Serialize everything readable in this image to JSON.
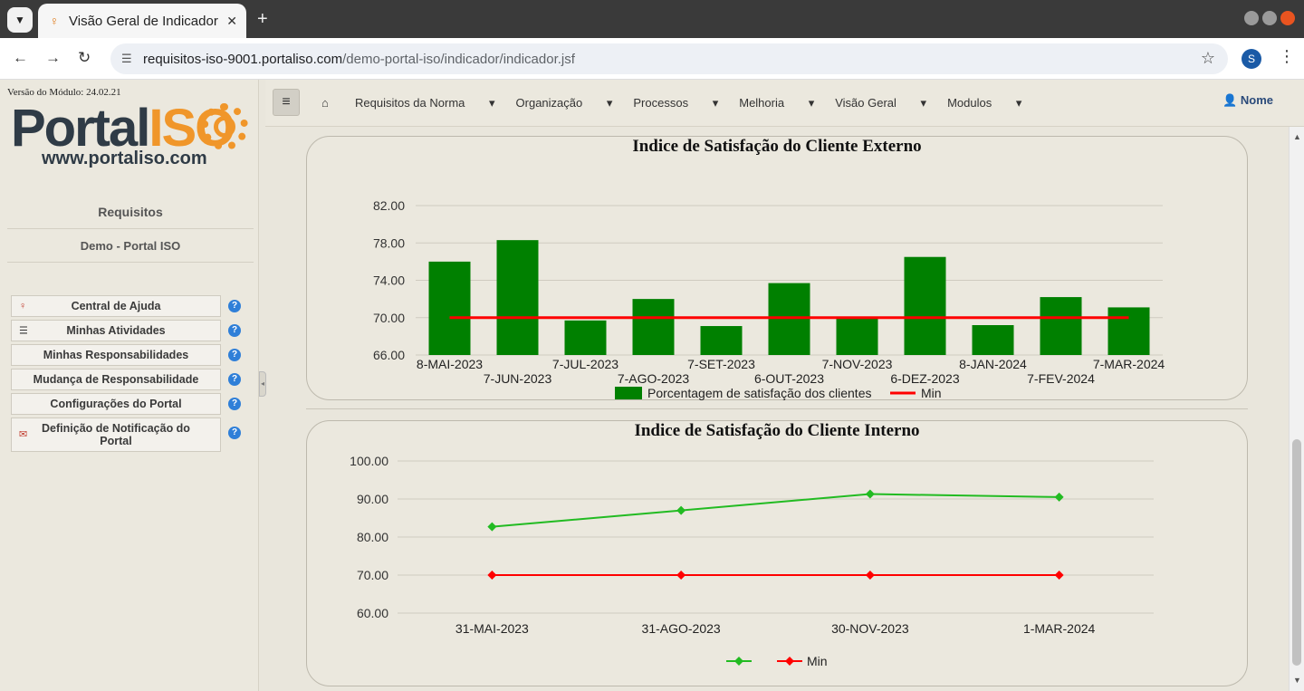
{
  "browser": {
    "tab_title": "Visão Geral de Indicador",
    "url_host": "requisitos-iso-9001.portaliso.com",
    "url_path": "/demo-portal-iso/indicador/indicador.jsf",
    "profile_initial": "S"
  },
  "sidebar": {
    "version": "Versão do Módulo: 24.02.21",
    "logo_text_a": "Portal",
    "logo_text_b": "ISO",
    "logo_url": "www.portaliso.com",
    "heading": "Requisitos",
    "subheading": "Demo - Portal ISO",
    "items": [
      {
        "label": "Central de Ajuda",
        "icon": "lightbulb-icon"
      },
      {
        "label": "Minhas Atividades",
        "icon": "list-icon"
      },
      {
        "label": "Minhas Responsabilidades",
        "icon": ""
      },
      {
        "label": "Mudança de Responsabilidade",
        "icon": ""
      },
      {
        "label": "Configurações do Portal",
        "icon": ""
      },
      {
        "label": "Definição de Notificação do Portal",
        "icon": "envelope-icon"
      }
    ],
    "help_glyph": "?"
  },
  "topnav": {
    "items": [
      "Requisitos da Norma",
      "Organização",
      "Processos",
      "Melhoria",
      "Visão Geral",
      "Modulos"
    ],
    "user": "Nome"
  },
  "chart_data": [
    {
      "type": "bar",
      "title": "Indice de Satisfação do Cliente Externo",
      "categories": [
        "8-MAI-2023",
        "7-JUN-2023",
        "7-JUL-2023",
        "7-AGO-2023",
        "7-SET-2023",
        "6-OUT-2023",
        "7-NOV-2023",
        "6-DEZ-2023",
        "8-JAN-2024",
        "7-FEV-2024",
        "7-MAR-2024"
      ],
      "series": [
        {
          "name": "Porcentagem de satisfação dos clientes",
          "values": [
            76.0,
            78.3,
            69.7,
            72.0,
            69.1,
            73.7,
            70.1,
            76.5,
            69.2,
            72.2,
            71.1
          ],
          "color": "#008000"
        },
        {
          "name": "Min",
          "values": [
            70,
            70,
            70,
            70,
            70,
            70,
            70,
            70,
            70,
            70,
            70
          ],
          "color": "#ff0000",
          "render": "line"
        }
      ],
      "yticks": [
        "82.00",
        "78.00",
        "74.00",
        "70.00",
        "66.00"
      ],
      "ylim": [
        66,
        82
      ]
    },
    {
      "type": "line",
      "title": "Indice de Satisfação do Cliente Interno",
      "categories": [
        "31-MAI-2023",
        "31-AGO-2023",
        "30-NOV-2023",
        "1-MAR-2024"
      ],
      "series": [
        {
          "name": "",
          "values": [
            82.7,
            87.0,
            91.3,
            90.5
          ],
          "color": "#22bb22"
        },
        {
          "name": "Min",
          "values": [
            70,
            70,
            70,
            70
          ],
          "color": "#ff0000"
        }
      ],
      "yticks": [
        "100.00",
        "90.00",
        "80.00",
        "70.00",
        "60.00"
      ],
      "ylim": [
        60,
        100
      ]
    }
  ]
}
